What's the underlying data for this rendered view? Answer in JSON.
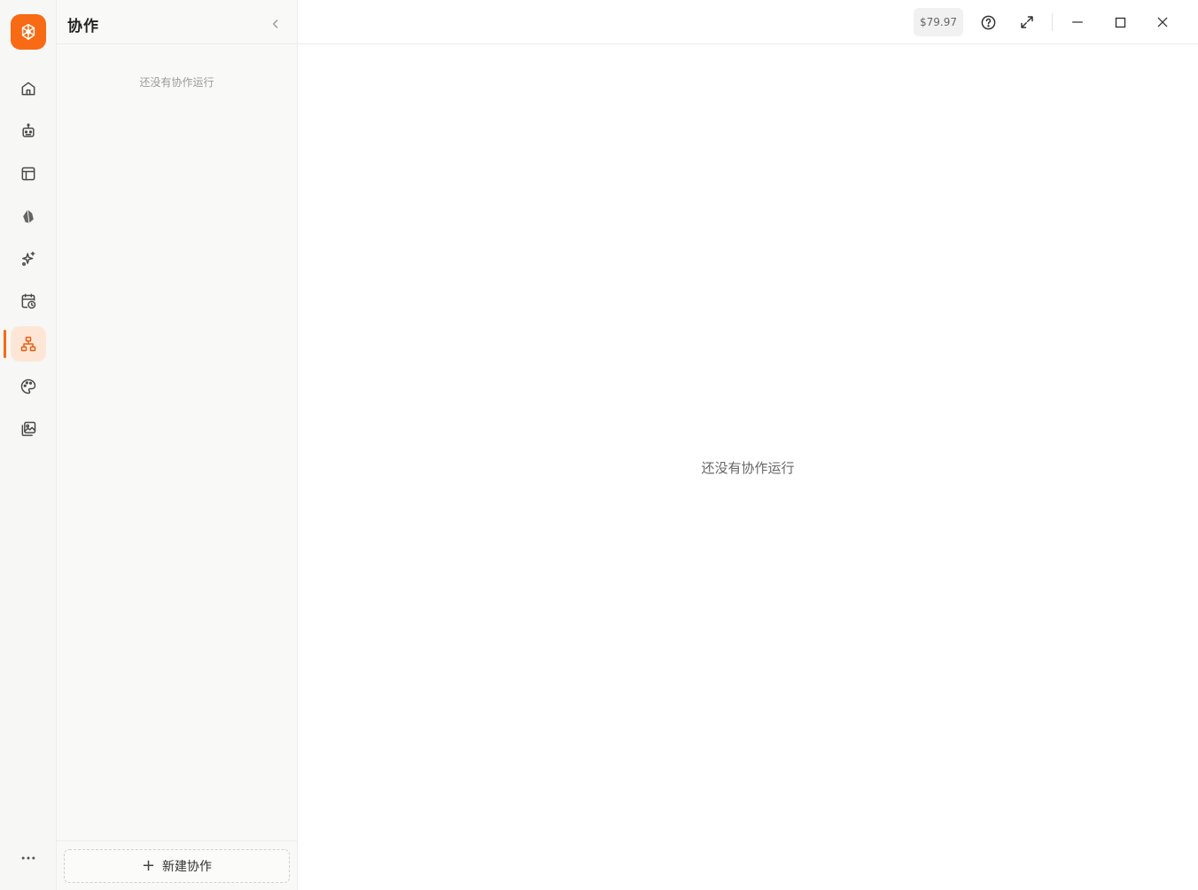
{
  "rail": {
    "logo_icon": "orange-app-logo",
    "items": [
      {
        "icon": "home-icon"
      },
      {
        "icon": "robot-icon"
      },
      {
        "icon": "layout-icon"
      },
      {
        "icon": "knowledge-icon"
      },
      {
        "icon": "sparkles-icon"
      },
      {
        "icon": "calendar-clock-icon"
      },
      {
        "icon": "network-icon",
        "active": true
      },
      {
        "icon": "palette-icon"
      },
      {
        "icon": "image-gallery-icon"
      }
    ],
    "more_icon": "more-icon"
  },
  "panel": {
    "title": "协作",
    "empty_text": "还没有协作运行",
    "new_button_label": "新建协作"
  },
  "topbar": {
    "balance": "$79.97"
  },
  "main": {
    "empty_text": "还没有协作运行"
  },
  "colors": {
    "accent": "#f86a14",
    "active_bg": "#fde6d6"
  }
}
